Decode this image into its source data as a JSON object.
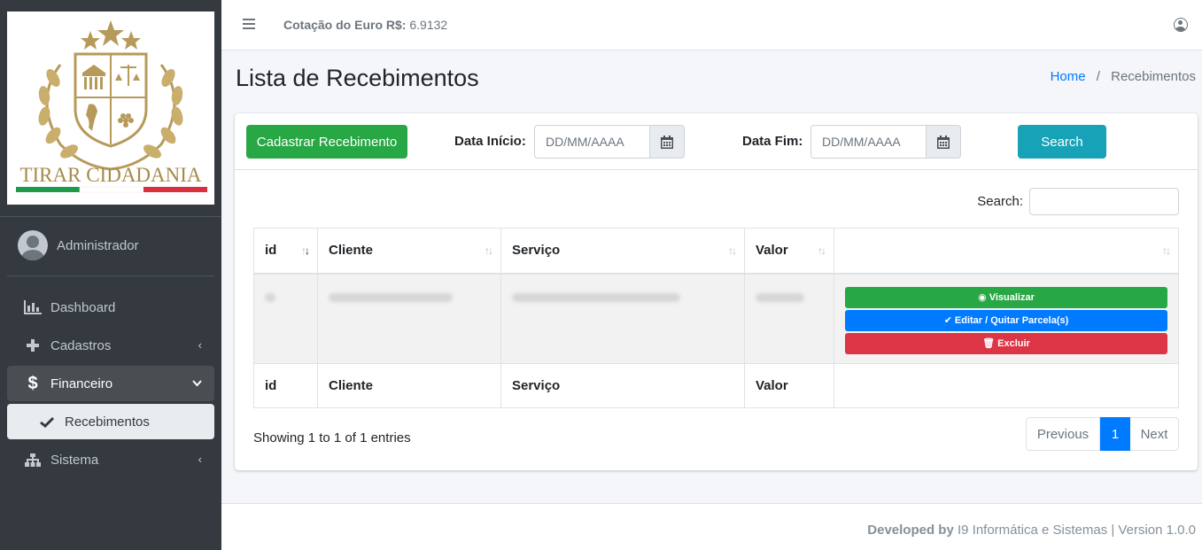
{
  "sidebar": {
    "logo_text": "TIRAR CIDADANIA",
    "user": "Administrador",
    "items": [
      {
        "label": "Dashboard",
        "icon": "chart-bar-icon"
      },
      {
        "label": "Cadastros",
        "icon": "plus-icon"
      },
      {
        "label": "Financeiro",
        "icon": "dollar-icon"
      },
      {
        "label": "Recebimentos",
        "icon": "check-icon"
      },
      {
        "label": "Sistema",
        "icon": "sitemap-icon"
      }
    ]
  },
  "header": {
    "euro_label": "Cotação do Euro R$:",
    "euro_value": "6.9132"
  },
  "page": {
    "title": "Lista de Recebimentos",
    "breadcrumb_home": "Home",
    "breadcrumb_sep": "/",
    "breadcrumb_current": "Recebimentos"
  },
  "toolbar": {
    "add_button": "Cadastrar Recebimento",
    "start_label": "Data Início:",
    "start_placeholder": "DD/MM/AAAA",
    "end_label": "Data Fim:",
    "end_placeholder": "DD/MM/AAAA",
    "search_button": "Search"
  },
  "table": {
    "search_label": "Search:",
    "columns": [
      "id",
      "Cliente",
      "Serviço",
      "Valor"
    ],
    "actions": {
      "view": "Visualizar",
      "edit": "Editar / Quitar Parcela(s)",
      "delete": "Excluir"
    },
    "showing": "Showing 1 to 1 of 1 entries",
    "pager": {
      "prev": "Previous",
      "current": "1",
      "next": "Next"
    }
  },
  "footer": {
    "developed_by": "Developed by",
    "company": "I9 Informática e Sistemas | Version 1.0.0"
  },
  "colors": {
    "sidebar_bg": "#343a40",
    "green": "#28a745",
    "blue": "#007bff",
    "red": "#dc3545",
    "teal": "#17a2b8",
    "gold": "#b79a5a"
  }
}
